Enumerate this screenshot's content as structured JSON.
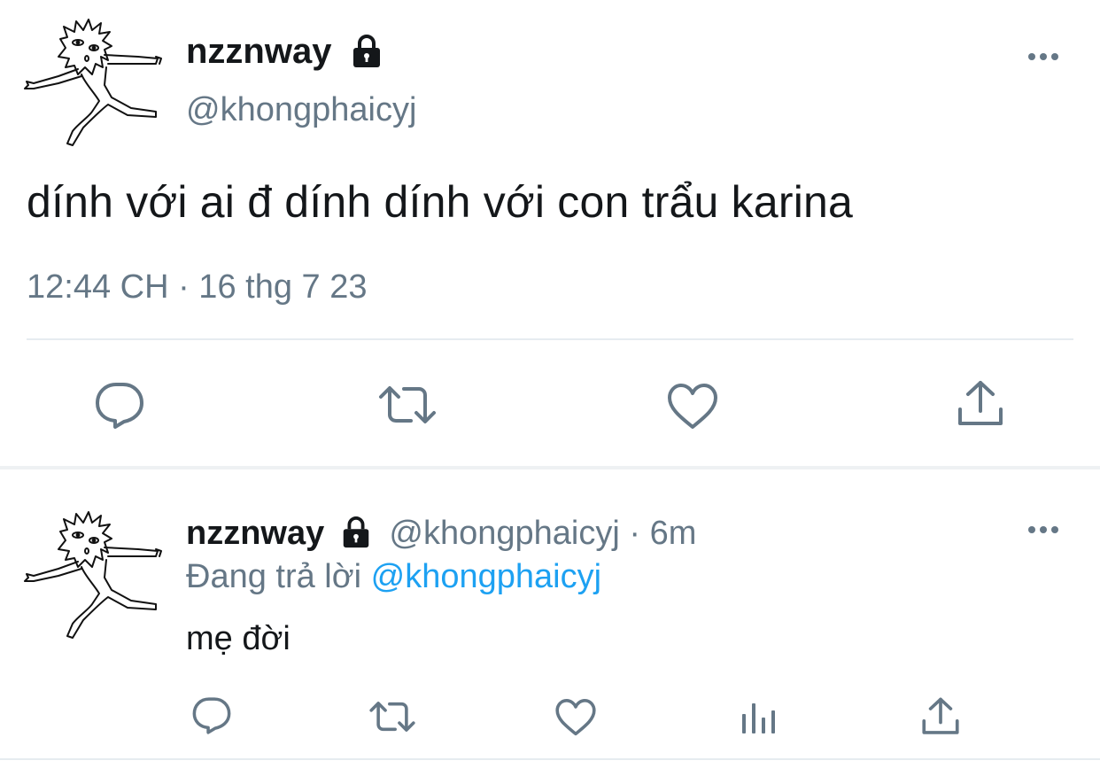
{
  "main_tweet": {
    "display_name": "nzznway",
    "handle": "@khongphaicyj",
    "text": "dính với ai đ dính dính với con trẩu karina",
    "timestamp": "12:44 CH · 16 thg 7 23",
    "icons": {
      "lock": "lock-icon",
      "more": "more-icon",
      "reply": "reply-icon",
      "retweet": "retweet-icon",
      "like": "heart-icon",
      "share": "share-icon"
    }
  },
  "reply_tweet": {
    "display_name": "nzznway",
    "handle": "@khongphaicyj",
    "separator": "·",
    "time_ago": "6m",
    "replying_prefix": "Đang trả lời",
    "replying_to": "@khongphaicyj",
    "text": "mẹ đời",
    "icons": {
      "lock": "lock-icon",
      "more": "more-icon",
      "reply": "reply-icon",
      "retweet": "retweet-icon",
      "like": "heart-icon",
      "analytics": "analytics-icon",
      "share": "share-icon"
    }
  },
  "colors": {
    "text_primary": "#14171a",
    "text_secondary": "#657786",
    "link": "#1da1f2",
    "divider": "#e6ecf0"
  }
}
